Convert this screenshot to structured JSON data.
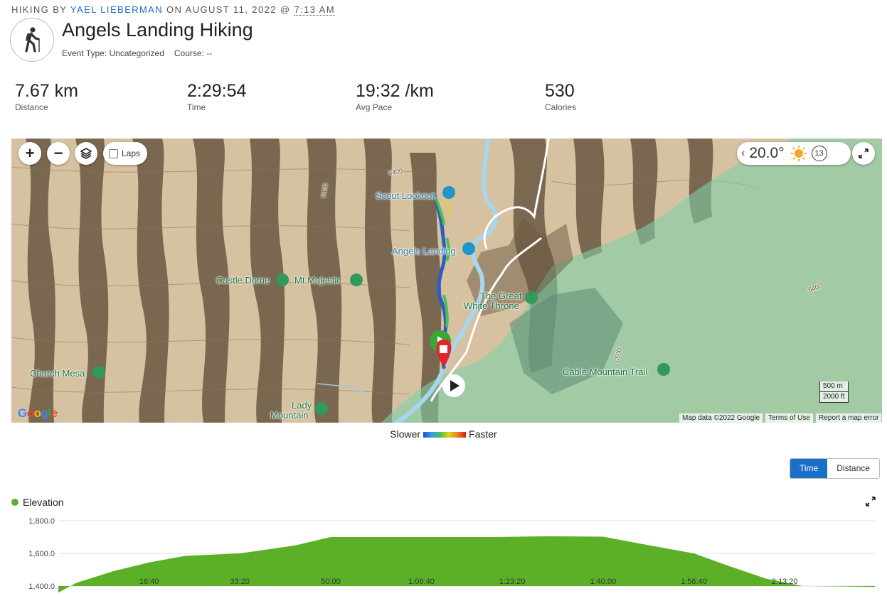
{
  "header": {
    "prefix": "HIKING BY",
    "author": "YAEL LIEBERMAN",
    "on": "ON AUGUST 11, 2022 @",
    "time": "7:13 AM",
    "title": "Angels Landing Hiking",
    "event_type": "Event Type: Uncategorized",
    "course": "Course: --",
    "activity_icon": "hiker-icon"
  },
  "stats": [
    {
      "value": "7.67 km",
      "label": "Distance"
    },
    {
      "value": "2:29:54",
      "label": "Time"
    },
    {
      "value": "19:32 /km",
      "label": "Avg Pace"
    },
    {
      "value": "530",
      "label": "Calories"
    }
  ],
  "map": {
    "laps_label": "Laps",
    "temperature": "20.0°",
    "wind": "13",
    "places": {
      "scout": "Scout Lookout",
      "angels": "Angels Landing",
      "castle": "Castle Dome",
      "majestic": "Mt Majestic",
      "throne1": "The Great",
      "throne2": "White Throne",
      "church": "Church Mesa",
      "cable": "Cable Mountain Trail",
      "lady1": "Lady",
      "lady2": "Mountain"
    },
    "contours": [
      "6400",
      "6400",
      "6400",
      "6500"
    ],
    "scale_m": "500 m",
    "scale_ft": "2000 ft",
    "attribution": "Map data ©2022 Google",
    "terms": "Terms of Use",
    "report": "Report a map error",
    "logo": "Google"
  },
  "speed_legend": {
    "slower": "Slower",
    "faster": "Faster"
  },
  "toggle": {
    "time": "Time",
    "distance": "Distance",
    "selected": "Time"
  },
  "colors": {
    "accent": "#1a6fc9",
    "elevation": "#5bb027",
    "start": "#3aa835",
    "stop": "#e0262b"
  },
  "chart_data": {
    "type": "area",
    "series": [
      {
        "name": "Elevation",
        "x": [
          0,
          200,
          600,
          1000,
          1400,
          2000,
          2600,
          3000,
          3600,
          4200,
          4800,
          5400,
          6000,
          6600,
          7000,
          7400,
          7800,
          8200,
          8994
        ],
        "y": [
          1360,
          1420,
          1490,
          1545,
          1585,
          1600,
          1648,
          1700,
          1700,
          1700,
          1700,
          1705,
          1702,
          1640,
          1600,
          1520,
          1445,
          1400,
          1395
        ]
      }
    ],
    "xlabel": "",
    "ylabel": "",
    "xticks": [
      "16:40",
      "33:20",
      "50:00",
      "1:06:40",
      "1:23:20",
      "1:40:00",
      "1:56:40",
      "2:13:20"
    ],
    "xtick_seconds": [
      1000,
      2000,
      3000,
      4000,
      5000,
      6000,
      7000,
      8000
    ],
    "yticks": [
      "1,800.0",
      "1,600.0",
      "1,400.0"
    ],
    "ytick_values": [
      1800,
      1600,
      1400
    ],
    "ylim": [
      1400,
      1800
    ],
    "xlim": [
      0,
      8994
    ],
    "grid": true
  }
}
